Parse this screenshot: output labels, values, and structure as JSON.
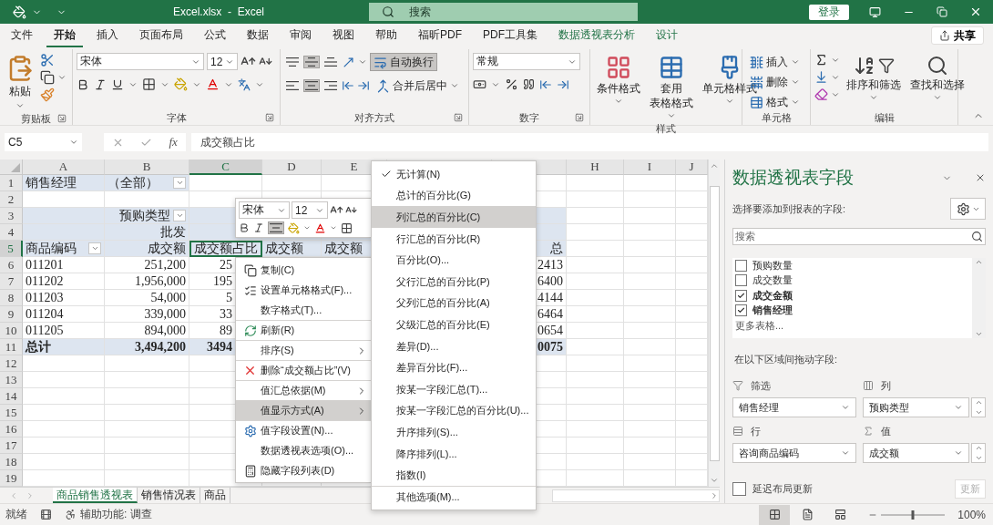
{
  "title_bar": {
    "title": "Excel.xlsx  -  Excel",
    "search": {
      "placeholder": "搜索"
    },
    "login": "登录"
  },
  "ribbon_tabs": [
    {
      "label": "文件",
      "selected": false,
      "kind": "plain"
    },
    {
      "label": "开始",
      "selected": true,
      "kind": "plain"
    },
    {
      "label": "插入",
      "selected": false,
      "kind": "plain"
    },
    {
      "label": "页面布局",
      "selected": false,
      "kind": "plain"
    },
    {
      "label": "公式",
      "selected": false,
      "kind": "plain"
    },
    {
      "label": "数据",
      "selected": false,
      "kind": "plain"
    },
    {
      "label": "审阅",
      "selected": false,
      "kind": "plain"
    },
    {
      "label": "视图",
      "selected": false,
      "kind": "plain"
    },
    {
      "label": "帮助",
      "selected": false,
      "kind": "plain"
    },
    {
      "label": "福昕PDF",
      "selected": false,
      "kind": "plain"
    },
    {
      "label": "PDF工具集",
      "selected": false,
      "kind": "plain"
    },
    {
      "label": "数据透视表分析",
      "selected": false,
      "kind": "context"
    },
    {
      "label": "设计",
      "selected": false,
      "kind": "context"
    }
  ],
  "share": "共享",
  "ribbon": {
    "clipboard": {
      "paste": "粘贴",
      "label": "剪贴板"
    },
    "font": {
      "name": "宋体",
      "size": "12",
      "label": "字体"
    },
    "alignment": {
      "vertical": [
        {
          "selected": false
        },
        {
          "selected": true
        },
        {
          "selected": false
        }
      ],
      "horizontal": [
        {
          "selected": false
        },
        {
          "selected": true
        },
        {
          "selected": false
        }
      ],
      "wrap": {
        "label": "自动换行",
        "selected": true
      },
      "merge": "合并后居中",
      "label": "对齐方式"
    },
    "number": {
      "format": "常规",
      "label": "数字"
    },
    "styles": {
      "buttons": [
        {
          "lines": [
            "条件格式"
          ]
        },
        {
          "lines": [
            "套用",
            "表格格式"
          ]
        },
        {
          "lines": [
            "单元格样式"
          ]
        }
      ],
      "label": "样式"
    },
    "cells": {
      "buttons": [
        "插入",
        "删除",
        "格式"
      ],
      "label": "单元格"
    },
    "editing": {
      "buttons": [
        "排序和筛选",
        "查找和选择"
      ],
      "label": "编辑"
    }
  },
  "formula_bar": {
    "name_box": "C5",
    "fx": "fx",
    "value": "成交额占比"
  },
  "sheet": {
    "columns": [
      {
        "letter": "A",
        "selected": false
      },
      {
        "letter": "B",
        "selected": false
      },
      {
        "letter": "C",
        "selected": true
      },
      {
        "letter": "D",
        "selected": false
      },
      {
        "letter": "E",
        "selected": false
      },
      {},
      {},
      {
        "letter": "H",
        "selected": false
      },
      {
        "letter": "I",
        "selected": false
      },
      {
        "letter": "J",
        "selected": false
      }
    ],
    "rows": [
      {
        "n": "1",
        "kind": "filter",
        "selected": false,
        "cells": [
          {
            "text": "销售经理"
          },
          {
            "text": "（全部）",
            "dropdown": true
          }
        ]
      },
      {
        "n": "2",
        "kind": "blank",
        "selected": false,
        "cells": []
      },
      {
        "n": "3",
        "kind": "head",
        "selected": false,
        "cells": [
          {},
          {
            "text": "预购类型",
            "dropdown": true
          }
        ]
      },
      {
        "n": "4",
        "kind": "head",
        "selected": false,
        "cells": [
          {},
          {
            "text": "批发"
          }
        ]
      },
      {
        "n": "5",
        "kind": "head",
        "selected": true,
        "cells": [
          {
            "text": "商品编码",
            "dropdown": true
          },
          {
            "text": "成交额"
          },
          {
            "text": "成交额占比",
            "selected": true
          },
          {
            "text": "成交额"
          },
          {
            "text": "成交额"
          },
          {},
          {
            "text": "总"
          }
        ]
      },
      {
        "n": "6",
        "kind": "data",
        "selected": false,
        "cells": [
          {
            "text": "011201"
          },
          {
            "text": "251,200"
          },
          {
            "text": "25"
          },
          {},
          {},
          {},
          {
            "text": "2413"
          }
        ]
      },
      {
        "n": "7",
        "kind": "data",
        "selected": false,
        "cells": [
          {
            "text": "011202"
          },
          {
            "text": "1,956,000"
          },
          {
            "text": "195"
          },
          {},
          {},
          {},
          {
            "text": "6400"
          }
        ]
      },
      {
        "n": "8",
        "kind": "data",
        "selected": false,
        "cells": [
          {
            "text": "011203"
          },
          {
            "text": "54,000"
          },
          {
            "text": "5"
          },
          {},
          {},
          {},
          {
            "text": "4144"
          }
        ]
      },
      {
        "n": "9",
        "kind": "data",
        "selected": false,
        "cells": [
          {
            "text": "011204"
          },
          {
            "text": "339,000"
          },
          {
            "text": "33"
          },
          {},
          {},
          {},
          {
            "text": "6464"
          }
        ]
      },
      {
        "n": "10",
        "kind": "data",
        "selected": false,
        "cells": [
          {
            "text": "011205"
          },
          {
            "text": "894,000"
          },
          {
            "text": "89"
          },
          {},
          {},
          {},
          {
            "text": "0654"
          }
        ]
      },
      {
        "n": "11",
        "kind": "total",
        "selected": false,
        "cells": [
          {
            "text": "总计"
          },
          {
            "text": "3,494,200"
          },
          {
            "text": "3494"
          },
          {},
          {},
          {},
          {
            "text": "0075"
          }
        ]
      },
      {
        "n": "12",
        "kind": "blank",
        "selected": false,
        "cells": []
      },
      {
        "n": "13",
        "kind": "blank",
        "selected": false,
        "cells": []
      },
      {
        "n": "14",
        "kind": "blank",
        "selected": false,
        "cells": []
      },
      {
        "n": "15",
        "kind": "blank",
        "selected": false,
        "cells": []
      },
      {
        "n": "16",
        "kind": "blank",
        "selected": false,
        "cells": []
      },
      {
        "n": "17",
        "kind": "blank",
        "selected": false,
        "cells": []
      },
      {
        "n": "18",
        "kind": "blank",
        "selected": false,
        "cells": []
      },
      {
        "n": "19",
        "kind": "blank",
        "selected": false,
        "cells": []
      }
    ]
  },
  "sheet_tabs": [
    {
      "label": "商品销售透视表",
      "selected": true
    },
    {
      "label": "销售情况表",
      "selected": false
    },
    {
      "label": "商品",
      "selected": false
    }
  ],
  "mini_toolbar": {
    "font": "宋体",
    "size": "12",
    "center": {
      "selected": true
    }
  },
  "context_menu": [
    {
      "label": "复制(C)",
      "kind": "copy",
      "submenu": false,
      "selected": false,
      "separator_before": false
    },
    {
      "label": "设置单元格格式(F)...",
      "kind": "format",
      "submenu": false,
      "selected": false,
      "separator_before": false
    },
    {
      "label": "数字格式(T)...",
      "kind": "plain",
      "submenu": false,
      "selected": false,
      "separator_before": false
    },
    {
      "label": "刷新(R)",
      "kind": "refresh",
      "submenu": false,
      "selected": false,
      "separator_before": true
    },
    {
      "label": "排序(S)",
      "kind": "plain",
      "submenu": true,
      "selected": false,
      "separator_before": true
    },
    {
      "label": "删除“成交额占比”(V)",
      "kind": "delete",
      "submenu": false,
      "selected": false,
      "separator_before": true
    },
    {
      "label": "值汇总依据(M)",
      "kind": "plain",
      "submenu": true,
      "selected": false,
      "separator_before": true
    },
    {
      "label": "值显示方式(A)",
      "kind": "plain",
      "submenu": true,
      "selected": true,
      "separator_before": false
    },
    {
      "label": "值字段设置(N)...",
      "kind": "settings",
      "submenu": false,
      "selected": false,
      "separator_before": true
    },
    {
      "label": "数据透视表选项(O)...",
      "kind": "plain",
      "submenu": false,
      "selected": false,
      "separator_before": false
    },
    {
      "label": "隐藏字段列表(D)",
      "kind": "hide",
      "submenu": false,
      "selected": false,
      "separator_before": false
    }
  ],
  "submenu": [
    {
      "label": "无计算(N)",
      "checked": true,
      "selected": false,
      "separator_before": false
    },
    {
      "label": "总计的百分比(G)",
      "checked": false,
      "selected": false,
      "separator_before": false
    },
    {
      "label": "列汇总的百分比(C)",
      "checked": false,
      "selected": true,
      "separator_before": false
    },
    {
      "label": "行汇总的百分比(R)",
      "checked": false,
      "selected": false,
      "separator_before": false
    },
    {
      "label": "百分比(O)...",
      "checked": false,
      "selected": false,
      "separator_before": false
    },
    {
      "label": "父行汇总的百分比(P)",
      "checked": false,
      "selected": false,
      "separator_before": false
    },
    {
      "label": "父列汇总的百分比(A)",
      "checked": false,
      "selected": false,
      "separator_before": false
    },
    {
      "label": "父级汇总的百分比(E)",
      "checked": false,
      "selected": false,
      "separator_before": false
    },
    {
      "label": "差异(D)...",
      "checked": false,
      "selected": false,
      "separator_before": false
    },
    {
      "label": "差异百分比(F)...",
      "checked": false,
      "selected": false,
      "separator_before": false
    },
    {
      "label": "按某一字段汇总(T)...",
      "checked": false,
      "selected": false,
      "separator_before": false
    },
    {
      "label": "按某一字段汇总的百分比(U)...",
      "checked": false,
      "selected": false,
      "separator_before": false
    },
    {
      "label": "升序排列(S)...",
      "checked": false,
      "selected": false,
      "separator_before": false
    },
    {
      "label": "降序排列(L)...",
      "checked": false,
      "selected": false,
      "separator_before": false
    },
    {
      "label": "指数(I)",
      "checked": false,
      "selected": false,
      "separator_before": false
    },
    {
      "label": "其他选项(M)...",
      "checked": false,
      "selected": false,
      "separator_before": true
    }
  ],
  "field_pane": {
    "title": "数据透视表字段",
    "prompt": "选择要添加到报表的字段:",
    "search": {
      "placeholder": "搜索"
    },
    "fields": [
      {
        "label": "预购数量",
        "checked": false
      },
      {
        "label": "成交数量",
        "checked": false
      },
      {
        "label": "成交金额",
        "checked": true
      },
      {
        "label": "销售经理",
        "checked": true
      }
    ],
    "more": "更多表格...",
    "drag_prompt": "在以下区域间拖动字段:",
    "areas": [
      {
        "kind": "filter",
        "label": "筛选",
        "value": "销售经理"
      },
      {
        "kind": "columns",
        "label": "列",
        "value": "预购类型"
      },
      {
        "kind": "rows",
        "label": "行",
        "value": "咨询商品编码"
      },
      {
        "kind": "values",
        "label": "值",
        "value": "成交额"
      }
    ],
    "defer": {
      "label": "延迟布局更新",
      "checked": false
    },
    "update": {
      "label": "更新",
      "disabled": true
    }
  },
  "status_bar": {
    "ready": "就绪",
    "accessibility": "辅助功能: 调查",
    "zoom_slider": {
      "level": 0.5
    },
    "zoom": "100%"
  }
}
